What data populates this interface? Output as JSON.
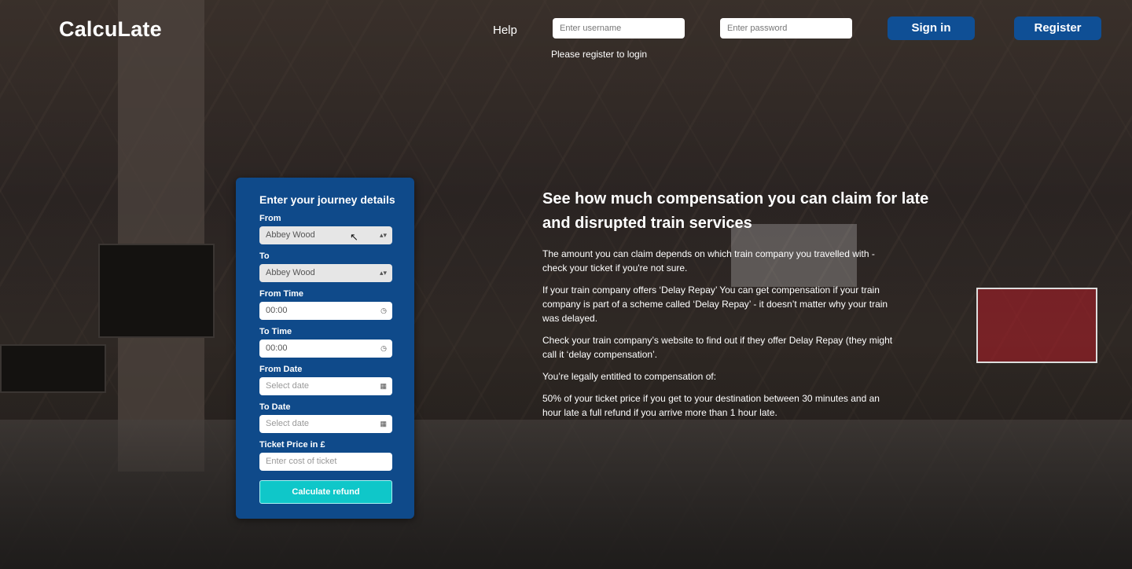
{
  "header": {
    "brand": "CalcuLate",
    "help": "Help",
    "username_placeholder": "Enter username",
    "password_placeholder": "Enter password",
    "login_note": "Please register to login",
    "sign_in": "Sign in",
    "register": "Register"
  },
  "form": {
    "title": "Enter your journey details",
    "from_label": "From",
    "from_value": "Abbey Wood",
    "to_label": "To",
    "to_value": "Abbey Wood",
    "from_time_label": "From Time",
    "from_time_value": "00:00",
    "to_time_label": "To Time",
    "to_time_value": "00:00",
    "from_date_label": "From Date",
    "from_date_placeholder": "Select date",
    "to_date_label": "To Date",
    "to_date_placeholder": "Select date",
    "price_label": "Ticket Price in £",
    "price_placeholder": "Enter cost of ticket",
    "submit": "Calculate refund"
  },
  "info": {
    "heading": "See how much compensation you can claim for late and disrupted train services",
    "p1": "The amount you can claim depends on which train company you travelled with - check your ticket if you're not sure.",
    "p2": "If your train company offers ‘Delay Repay’ You can get compensation if your train company is part of a scheme called ‘Delay Repay’ - it doesn’t matter why your train was delayed.",
    "p3": "Check your train company’s website to find out if they offer Delay Repay (they might call it ‘delay compensation’.",
    "p4": "You’re legally entitled to compensation of:",
    "p5": "50% of your ticket price if you get to your destination between 30 minutes and an hour late a full refund if you arrive more than 1 hour late."
  },
  "colors": {
    "brand_blue": "#0f4f95",
    "panel_blue": "#0f4a8a",
    "accent_cyan": "#0fc7c9"
  }
}
